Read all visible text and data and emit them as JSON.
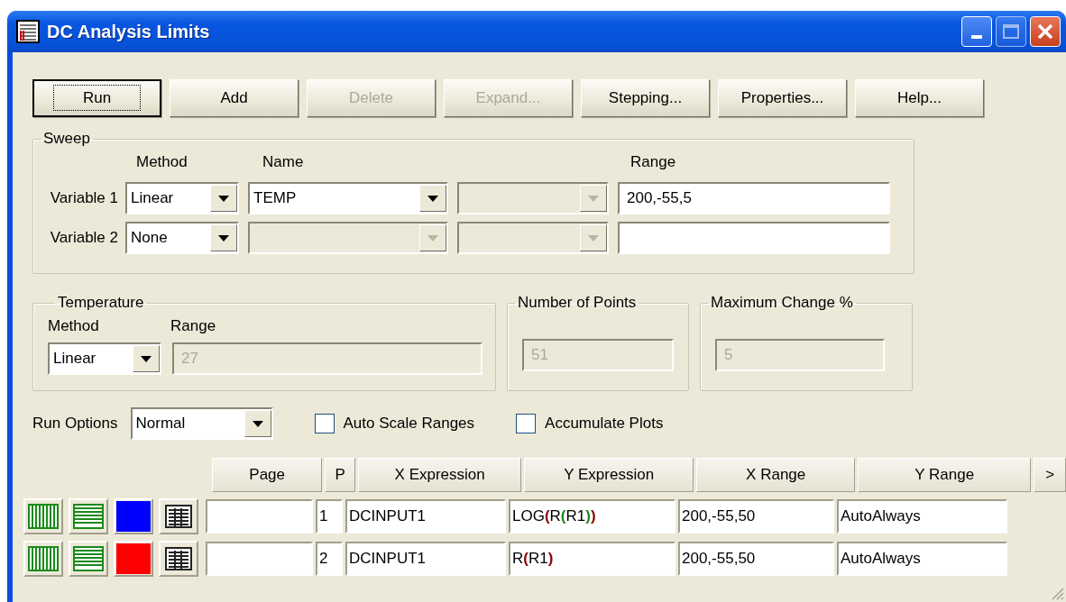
{
  "window": {
    "title": "DC Analysis Limits"
  },
  "buttons": [
    {
      "label": "Run",
      "disabled": false,
      "default": true
    },
    {
      "label": "Add",
      "disabled": false,
      "default": false
    },
    {
      "label": "Delete",
      "disabled": true,
      "default": false
    },
    {
      "label": "Expand...",
      "disabled": true,
      "default": false
    },
    {
      "label": "Stepping...",
      "disabled": false,
      "default": false
    },
    {
      "label": "Properties...",
      "disabled": false,
      "default": false
    },
    {
      "label": "Help...",
      "disabled": false,
      "default": false
    }
  ],
  "sweep": {
    "title": "Sweep",
    "method_label": "Method",
    "name_label": "Name",
    "range_label": "Range",
    "variables": [
      {
        "label": "Variable 1",
        "method": {
          "value": "Linear",
          "disabled": false
        },
        "name": {
          "value": "TEMP",
          "disabled": false
        },
        "parameter": {
          "disabled": true
        },
        "range": {
          "value": "200,-55,5",
          "disabled": false
        }
      },
      {
        "label": "Variable 2",
        "method": {
          "value": "None",
          "disabled": false
        },
        "name": {
          "disabled": true
        },
        "parameter": {
          "disabled": true
        },
        "range": {
          "disabled": false
        }
      }
    ]
  },
  "temperature": {
    "title": "Temperature",
    "method_label": "Method",
    "range_label": "Range",
    "method": {
      "value": "Linear",
      "disabled": false
    },
    "range": {
      "value": "27",
      "disabled": true
    }
  },
  "number_of_points": {
    "title": "Number of Points",
    "value": "51",
    "disabled": true
  },
  "maximum_change": {
    "title": "Maximum Change %",
    "value": "5",
    "disabled": true
  },
  "run_options": {
    "label": "Run Options",
    "value": "Normal"
  },
  "checkboxes": [
    {
      "label": "Auto Scale Ranges",
      "checked": false
    },
    {
      "label": "Accumulate Plots",
      "checked": false
    }
  ],
  "table": {
    "columns": [
      "Page",
      "P",
      "X Expression",
      "Y Expression",
      "X Range",
      "Y Range",
      ">"
    ],
    "rows": [
      {
        "p": "1",
        "x_expression": "DCINPUT1",
        "y_expression": "LOG(R(R1))",
        "x_range": "200,-55,50",
        "y_range": "AutoAlways",
        "color": "#0000ff"
      },
      {
        "p": "2",
        "x_expression": "DCINPUT1",
        "y_expression": "R(R1)",
        "x_range": "200,-55,50",
        "y_range": "AutoAlways",
        "color": "#ff0000"
      }
    ]
  }
}
